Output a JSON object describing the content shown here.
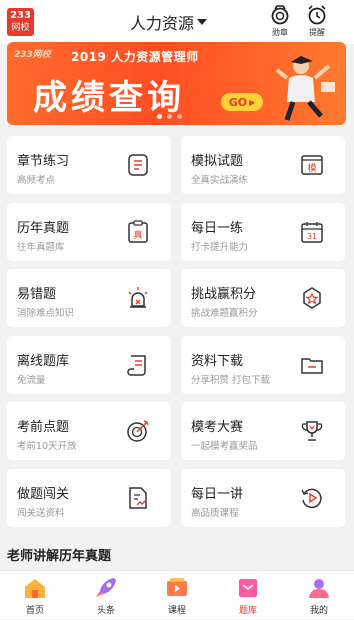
{
  "header": {
    "logo_top": "233",
    "logo_bottom": "网校",
    "title": "人力资源",
    "medal_label": "勋章",
    "remind_label": "提醒"
  },
  "banner": {
    "brand": "233网校",
    "top_text": "2019 人力资源管理师",
    "main_text": "成绩查询",
    "go_label": "GO"
  },
  "grid": [
    {
      "title": "章节练习",
      "subtitle": "高频考点",
      "icon": "list-icon"
    },
    {
      "title": "模拟试题",
      "subtitle": "全真实战演练",
      "icon": "mock-exam-icon",
      "icon_text": "模"
    },
    {
      "title": "历年真题",
      "subtitle": "往年真题库",
      "icon": "past-paper-icon",
      "icon_text": "真"
    },
    {
      "title": "每日一练",
      "subtitle": "打卡提升能力",
      "icon": "calendar-icon",
      "icon_text": "31"
    },
    {
      "title": "易错题",
      "subtitle": "消除难点知识",
      "icon": "alarm-icon"
    },
    {
      "title": "挑战赢积分",
      "subtitle": "挑战难题赢积分",
      "icon": "badge-icon"
    },
    {
      "title": "离线题库",
      "subtitle": "免流量",
      "icon": "offline-scroll-icon"
    },
    {
      "title": "资料下载",
      "subtitle": "分享积赞 打包下载",
      "icon": "folder-icon"
    },
    {
      "title": "考前点题",
      "subtitle": "考前10天开放",
      "icon": "target-icon"
    },
    {
      "title": "模考大赛",
      "subtitle": "一起模考赢奖品",
      "icon": "trophy-icon"
    },
    {
      "title": "做题闯关",
      "subtitle": "闯关送资料",
      "icon": "document-chart-icon"
    },
    {
      "title": "每日一讲",
      "subtitle": "高品质课程",
      "icon": "replay-icon"
    }
  ],
  "section_title": "老师讲解历年真题",
  "nav": [
    {
      "label": "首页",
      "icon": "home-icon"
    },
    {
      "label": "头条",
      "icon": "rocket-icon"
    },
    {
      "label": "课程",
      "icon": "course-icon"
    },
    {
      "label": "题库",
      "icon": "question-bank-icon",
      "active": true
    },
    {
      "label": "我的",
      "icon": "profile-icon"
    }
  ],
  "colors": {
    "accent": "#e83a2a",
    "banner": "#ff5a26",
    "go_button": "#ffd23a"
  }
}
